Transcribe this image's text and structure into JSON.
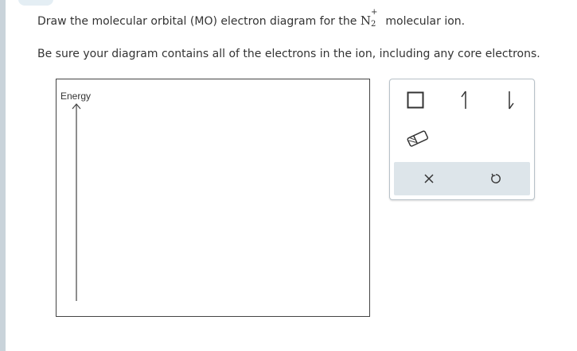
{
  "instructions": {
    "line1_before": "Draw the molecular orbital (MO) electron diagram for the",
    "ion_symbol": "N",
    "ion_subscript": "2",
    "ion_superscript": "+",
    "line1_after": "molecular ion.",
    "line2": "Be sure your diagram contains all of the electrons in the ion, including any core electrons."
  },
  "canvas": {
    "axis_label": "Energy"
  },
  "toolbox": {
    "tools": [
      {
        "name": "orbital-box",
        "icon": "square-icon"
      },
      {
        "name": "spin-up-electron",
        "icon": "half-arrow-up-icon"
      },
      {
        "name": "spin-down-electron",
        "icon": "half-arrow-down-icon"
      },
      {
        "name": "eraser",
        "icon": "eraser-icon"
      }
    ],
    "actions": [
      {
        "name": "clear",
        "icon": "x-icon"
      },
      {
        "name": "undo",
        "icon": "undo-icon"
      }
    ]
  },
  "colors": {
    "side_bar": "#c9d3da",
    "action_bar": "#dde5ea",
    "text": "#333333"
  }
}
